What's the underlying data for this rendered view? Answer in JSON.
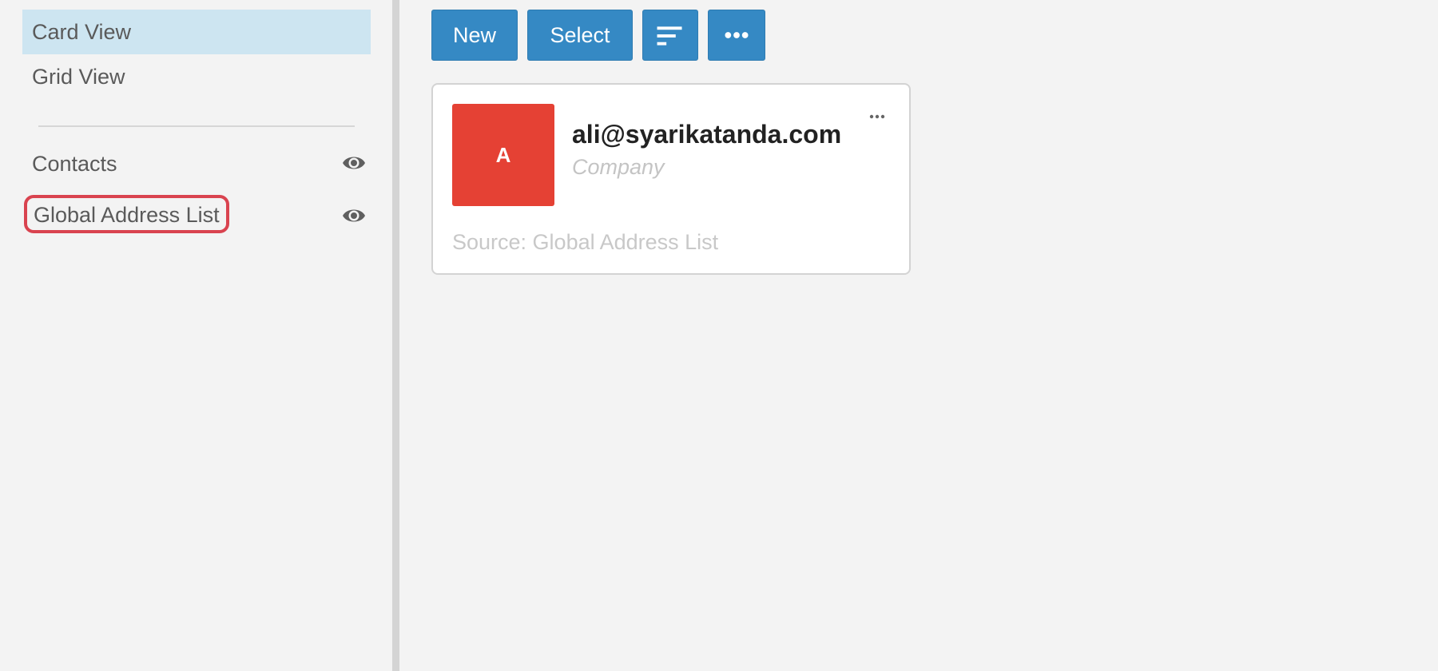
{
  "sidebar": {
    "views": [
      {
        "label": "Card View",
        "active": true
      },
      {
        "label": "Grid View",
        "active": false
      }
    ],
    "sources": [
      {
        "label": "Contacts",
        "icon": "eye-icon"
      },
      {
        "label": "Global Address List",
        "icon": "eye-icon"
      }
    ]
  },
  "toolbar": {
    "new_label": "New",
    "select_label": "Select",
    "sort_icon": "sort-icon",
    "more_icon": "more-horizontal-icon"
  },
  "card": {
    "avatar_letter": "A",
    "name": "ali@syarikatanda.com",
    "company": "Company",
    "source": "Source: Global Address List",
    "menu_icon": "more-horizontal-icon"
  },
  "colors": {
    "accent": "#3589c4",
    "active_view_bg": "#cde5f1",
    "avatar_bg": "#e54134",
    "highlight": "#d9434f"
  }
}
